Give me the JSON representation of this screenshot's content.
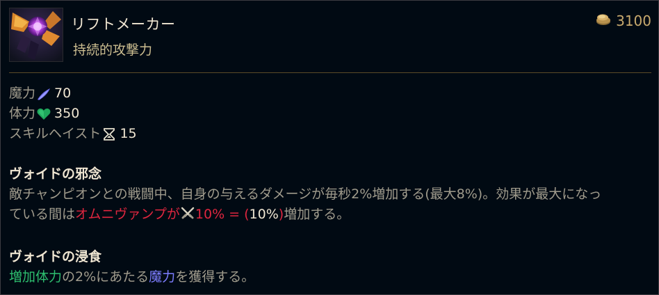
{
  "item": {
    "name": "リフトメーカー",
    "subtitle": "持続的攻撃力",
    "icon": "riftmaker-item-icon",
    "price": "3100",
    "price_icon": "gold-coin-icon"
  },
  "stats": [
    {
      "label": "魔力",
      "icon": "ability-power-icon",
      "value": "70"
    },
    {
      "label": "体力",
      "icon": "health-heart-icon",
      "value": "350"
    },
    {
      "label": "スキルヘイスト",
      "icon": "hourglass-icon",
      "value": "15"
    }
  ],
  "passives": [
    {
      "title": "ヴォイドの邪念",
      "text_1": "敵チャンピオンとの戦闘中、自身の与えるダメージが毎秒2%増加する(最大8%)。効果が最大になっ",
      "text_2a": "ている間は",
      "text_2b": "オムニヴァンプが",
      "text_2_icon": "crossed-swords-icon",
      "text_2c": "10% = (",
      "text_2d": "10%",
      "text_2e": ")",
      "text_2f": "増加する。"
    },
    {
      "title": "ヴォイドの浸食",
      "text_a": "増加体力",
      "text_b": "の2%にあたる",
      "text_c": "魔力",
      "text_d": "を獲得する。"
    }
  ],
  "colors": {
    "gold": "#c8aa6e",
    "highlight_red": "#e0263f",
    "health_green": "#2dbd6e",
    "ability_blue": "#7d7dff"
  }
}
